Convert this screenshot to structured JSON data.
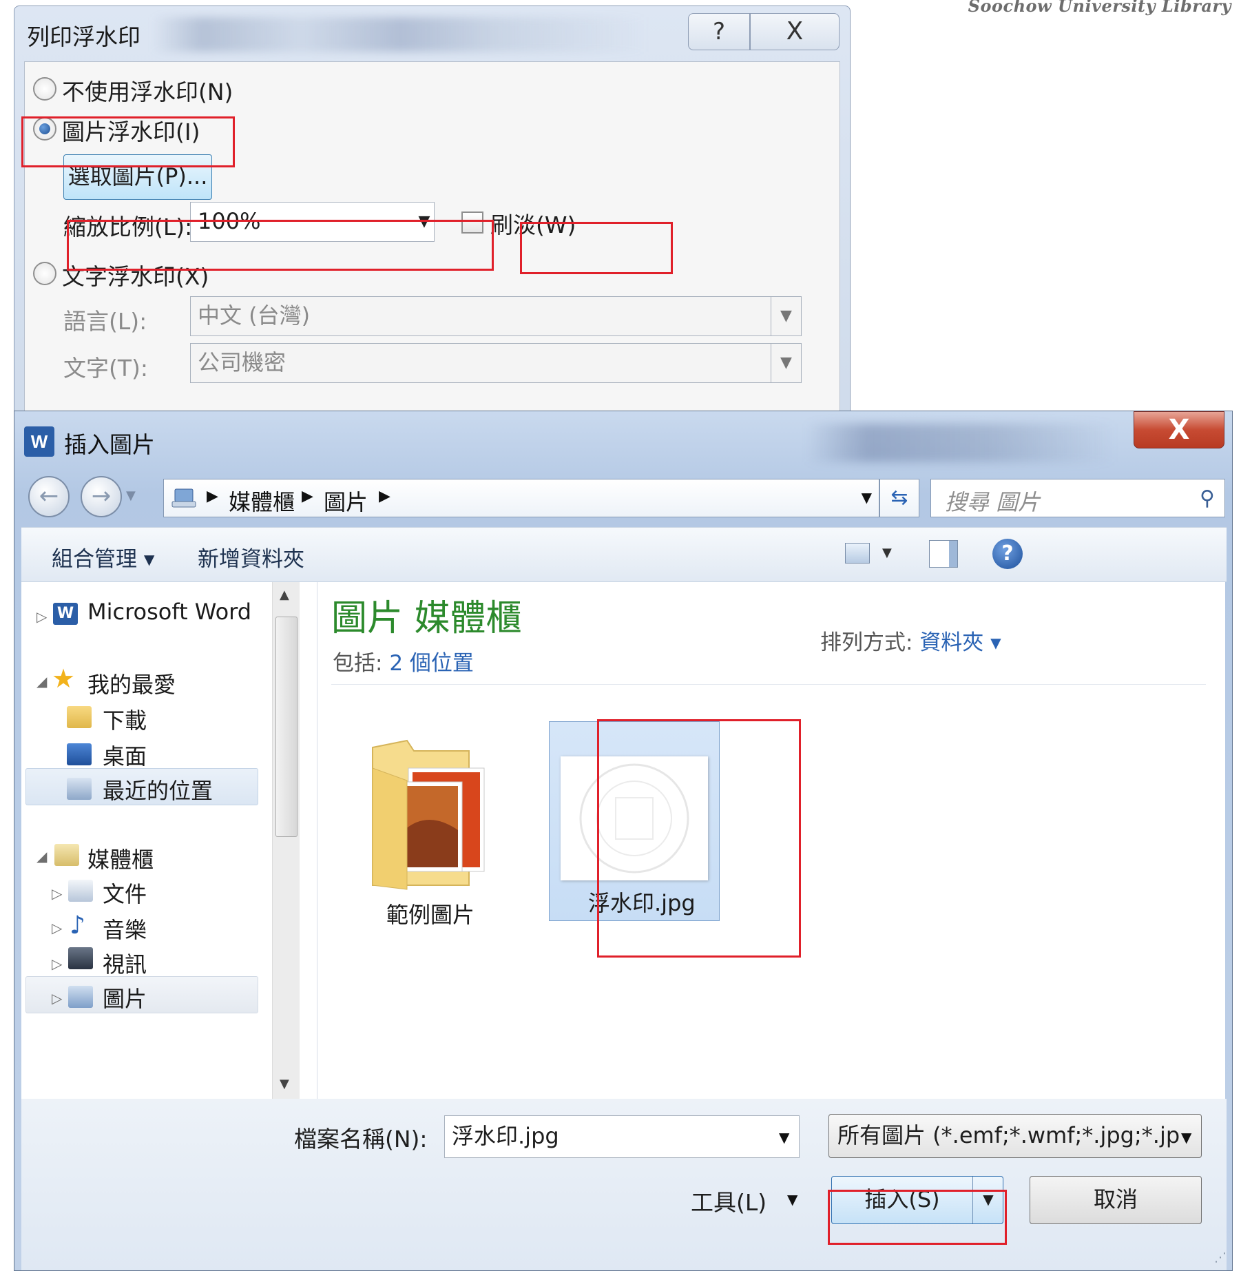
{
  "watermark_text": "Soochow University Library",
  "print_dialog": {
    "title": "列印浮水印",
    "help_glyph": "?",
    "close_glyph": "X",
    "no_watermark_label": "不使用浮水印(N)",
    "picture_watermark_label": "圖片浮水印(I)",
    "select_picture_button": "選取圖片(P)...",
    "scale_label": "縮放比例(L):",
    "scale_value": "100%",
    "washout_label": "刷淡(W)",
    "text_watermark_label": "文字浮水印(X)",
    "language_label": "語言(L):",
    "language_value": "中文 (台灣)",
    "text_label": "文字(T):",
    "text_value": "公司機密",
    "selected_option": "picture"
  },
  "insert_dialog": {
    "title": "插入圖片",
    "app_icon_letter": "W",
    "close_glyph": "X",
    "breadcrumbs": [
      "媒體櫃",
      "圖片"
    ],
    "search_placeholder": "搜尋 圖片",
    "toolbar": {
      "organize": "組合管理 ▾",
      "new_folder": "新增資料夾"
    },
    "nav": {
      "word": "Microsoft Word",
      "favorites": "我的最愛",
      "downloads": "下載",
      "desktop": "桌面",
      "recent": "最近的位置",
      "libraries": "媒體櫃",
      "documents": "文件",
      "music": "音樂",
      "videos": "視訊",
      "pictures": "圖片"
    },
    "library_title": "圖片 媒體櫃",
    "includes_label": "包括:",
    "includes_link": "2 個位置",
    "sort_label": "排列方式:",
    "sort_value": "資料夾 ▾",
    "items": [
      {
        "name": "範例圖片",
        "kind": "folder"
      },
      {
        "name": "浮水印.jpg",
        "kind": "image",
        "selected": true
      }
    ],
    "filename_label": "檔案名稱(N):",
    "filename_value": "浮水印.jpg",
    "filetype_value": "所有圖片 (*.emf;*.wmf;*.jpg;*.jp",
    "tools_label": "工具(L)",
    "insert_button": "插入(S)",
    "cancel_button": "取消"
  },
  "colors": {
    "highlight_red": "#e0202a",
    "library_title_green": "#2c8a2c",
    "link_blue": "#2a63b4"
  }
}
